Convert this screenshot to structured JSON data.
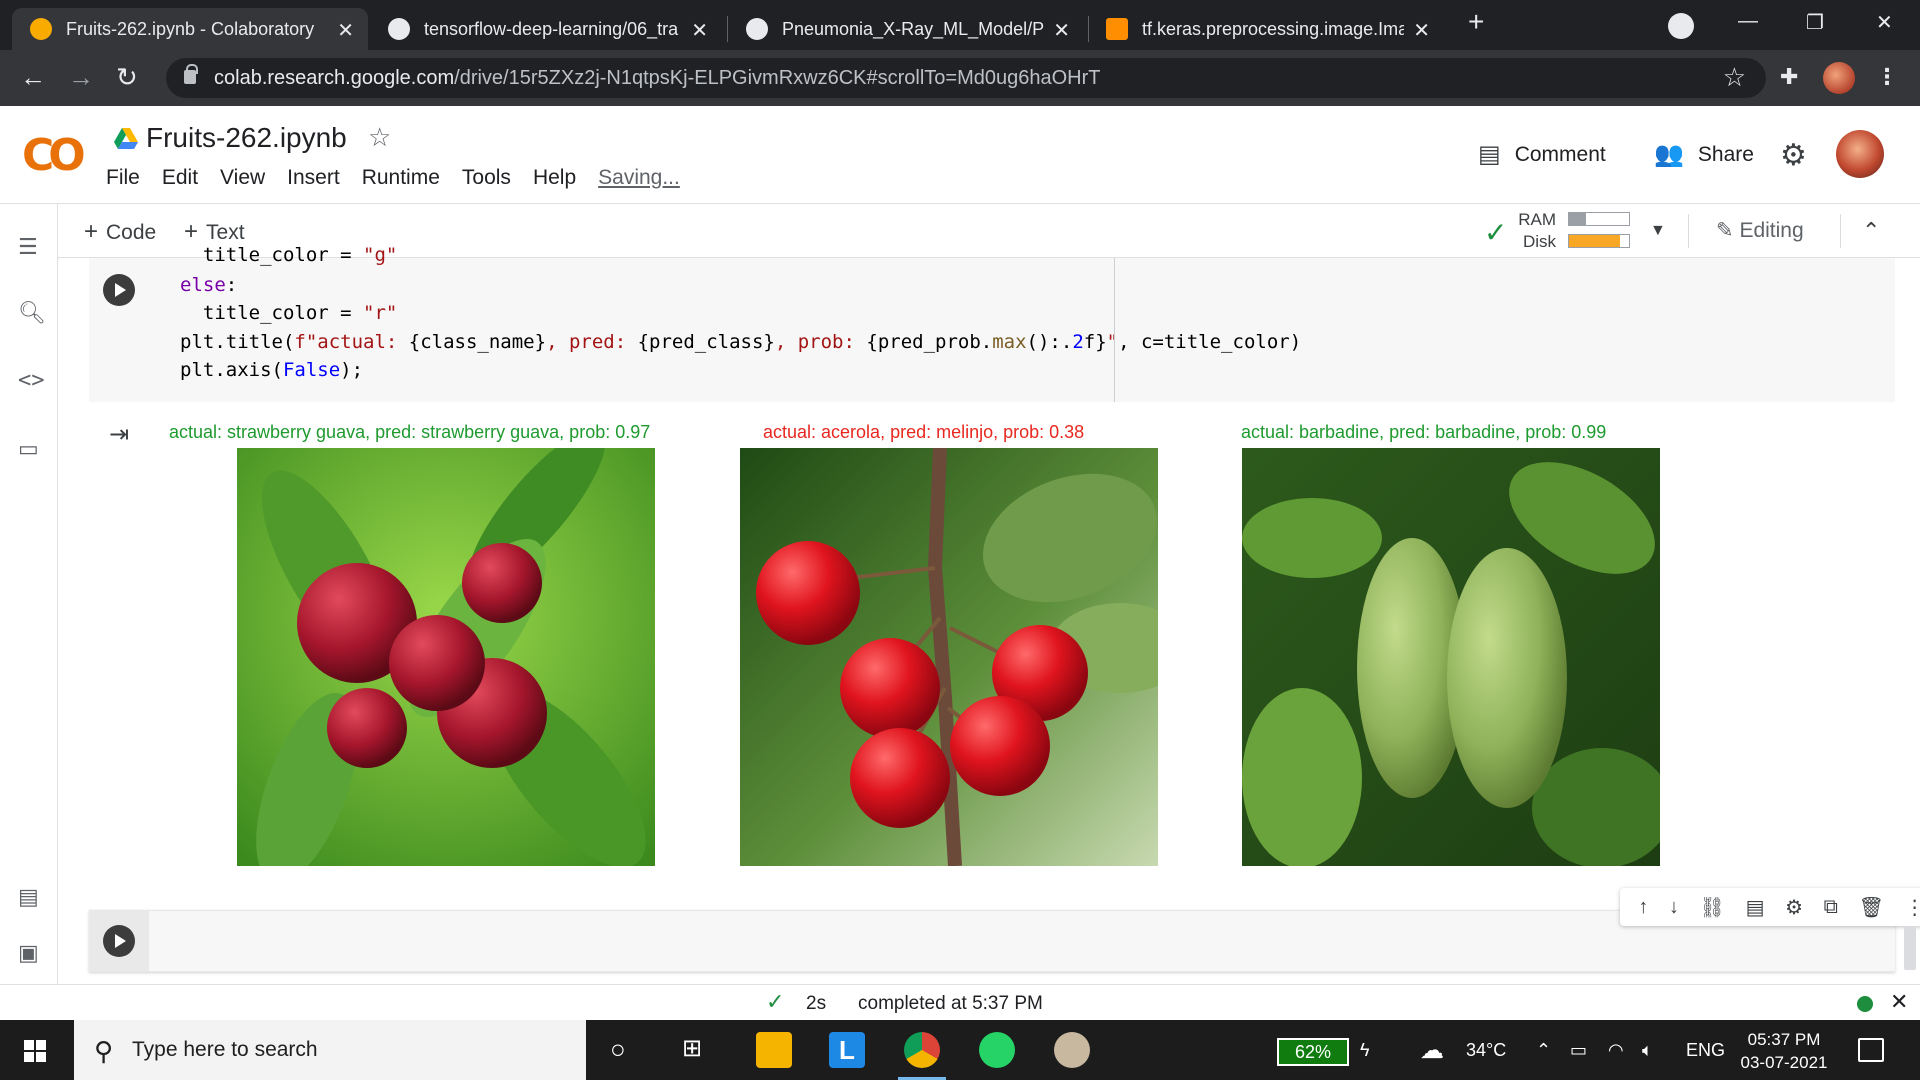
{
  "browser": {
    "tabs": [
      {
        "title": "Fruits-262.ipynb - Colaboratory",
        "active": true
      },
      {
        "title": "tensorflow-deep-learning/06_tra",
        "active": false
      },
      {
        "title": "Pneumonia_X-Ray_ML_Model/Pr",
        "active": false
      },
      {
        "title": "tf.keras.preprocessing.image.Ima",
        "active": false
      }
    ],
    "url_host": "colab.research.google.com",
    "url_path": "/drive/15r5ZXz2j-N1qtpsKj-ELPGivmRxwz6CK#scrollTo=Md0ug6haOHrT"
  },
  "colab": {
    "logo_text": "CO",
    "notebook_title": "Fruits-262.ipynb",
    "menu": [
      "File",
      "Edit",
      "View",
      "Insert",
      "Runtime",
      "Tools",
      "Help"
    ],
    "saving_label": "Saving...",
    "comment_label": "Comment",
    "share_label": "Share",
    "add_code_label": "Code",
    "add_text_label": "Text",
    "ram_label": "RAM",
    "disk_label": "Disk",
    "ram_usage": 0.28,
    "disk_usage": 0.85,
    "editing_label": "Editing"
  },
  "cell": {
    "code_lines": [
      "  title_color = \"g\"",
      "else:",
      "  title_color = \"r\"",
      "plt.title(f\"actual: {class_name}, pred: {pred_class}, prob: {pred_prob.max():.2f}\", c=title_color)",
      "plt.axis(False);"
    ]
  },
  "output": {
    "figures": [
      {
        "title": "actual: strawberry guava, pred: strawberry guava, prob: 0.97",
        "color": "#1e9a2e"
      },
      {
        "title": "actual: acerola, pred: melinjo, prob: 0.38",
        "color": "#e8281f"
      },
      {
        "title": "actual: barbadine, pred: barbadine, prob: 0.99",
        "color": "#1e9a2e"
      }
    ]
  },
  "status": {
    "duration": "2s",
    "completed": "completed at 5:37 PM"
  },
  "taskbar": {
    "search_placeholder": "Type here to search",
    "battery": "62%",
    "weather": "34°C",
    "lang": "ENG",
    "time": "05:37 PM",
    "date": "03-07-2021"
  },
  "colors": {
    "ok_green": "#1e8e3e",
    "ram_bar": "#9aa0a6",
    "disk_bar": "#f9a825"
  }
}
